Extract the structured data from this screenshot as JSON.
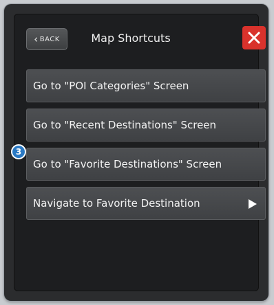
{
  "header": {
    "back_label": "BACK",
    "title": "Map Shortcuts"
  },
  "menu": {
    "items": [
      {
        "label": "Go to \"POI Categories\" Screen",
        "has_arrow": false
      },
      {
        "label": "Go to \"Recent Destinations\" Screen",
        "has_arrow": false
      },
      {
        "label": "Go to \"Favorite Destinations\" Screen",
        "has_arrow": false
      },
      {
        "label": "Navigate to Favorite Destination",
        "has_arrow": true
      }
    ]
  },
  "callout": {
    "number": "3"
  },
  "colors": {
    "close": "#d9322c",
    "callout": "#2a79c4"
  },
  "icons": {
    "back": "chevron-left-icon",
    "close": "close-icon",
    "submenu": "play-arrow-icon"
  }
}
